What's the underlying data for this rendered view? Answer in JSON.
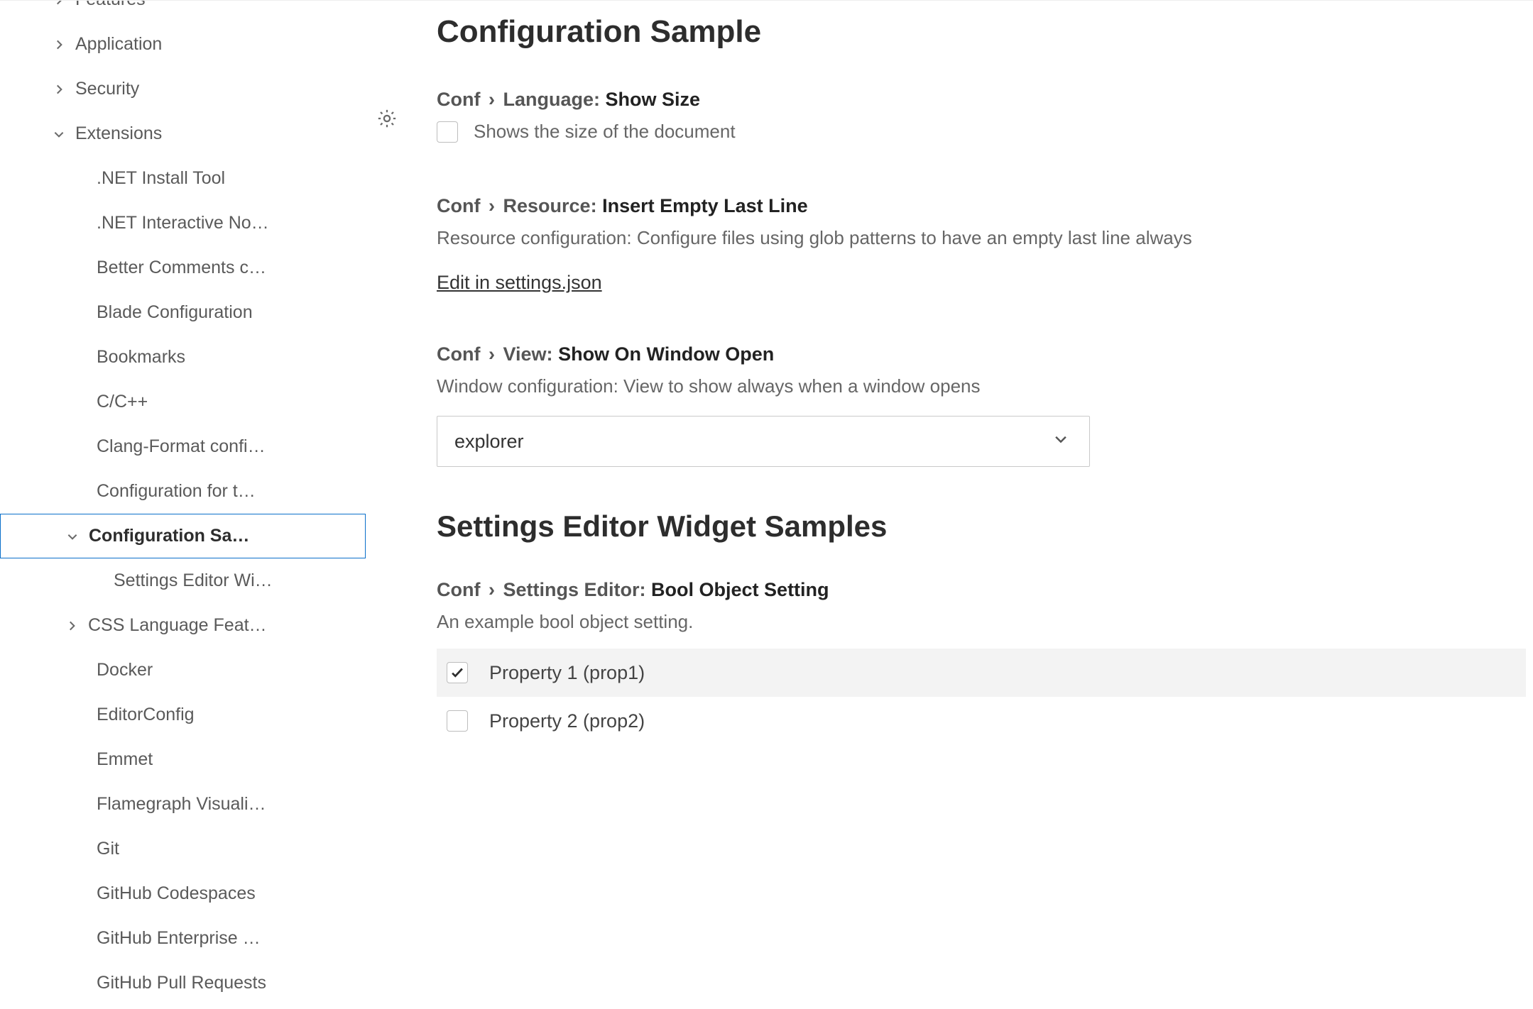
{
  "sidebar": {
    "nodes": [
      {
        "label": "Features",
        "indent": 0,
        "hasChevron": true,
        "chev": "right",
        "selected": false
      },
      {
        "label": "Application",
        "indent": 0,
        "hasChevron": true,
        "chev": "right",
        "selected": false
      },
      {
        "label": "Security",
        "indent": 0,
        "hasChevron": true,
        "chev": "right",
        "selected": false
      },
      {
        "label": "Extensions",
        "indent": 0,
        "hasChevron": true,
        "chev": "down",
        "selected": false
      },
      {
        "label": ".NET Install Tool",
        "indent": 1,
        "hasChevron": false,
        "selected": false
      },
      {
        "label": ".NET Interactive No…",
        "indent": 1,
        "hasChevron": false,
        "selected": false
      },
      {
        "label": "Better Comments c…",
        "indent": 1,
        "hasChevron": false,
        "selected": false
      },
      {
        "label": "Blade Configuration",
        "indent": 1,
        "hasChevron": false,
        "selected": false
      },
      {
        "label": "Bookmarks",
        "indent": 1,
        "hasChevron": false,
        "selected": false
      },
      {
        "label": "C/C++",
        "indent": 1,
        "hasChevron": false,
        "selected": false
      },
      {
        "label": "Clang-Format confi…",
        "indent": 1,
        "hasChevron": false,
        "selected": false
      },
      {
        "label": "Configuration for t…",
        "indent": 1,
        "hasChevron": false,
        "selected": false
      },
      {
        "label": "Configuration Sa…",
        "indent": 1,
        "hasChevron": true,
        "chev": "down",
        "selected": true
      },
      {
        "label": "Settings Editor Wi…",
        "indent": 2,
        "hasChevron": false,
        "selected": false
      },
      {
        "label": "CSS Language Feat…",
        "indent": 1,
        "hasChevron": true,
        "chev": "right",
        "selected": false
      },
      {
        "label": "Docker",
        "indent": 1,
        "hasChevron": false,
        "selected": false
      },
      {
        "label": "EditorConfig",
        "indent": 1,
        "hasChevron": false,
        "selected": false
      },
      {
        "label": "Emmet",
        "indent": 1,
        "hasChevron": false,
        "selected": false
      },
      {
        "label": "Flamegraph Visuali…",
        "indent": 1,
        "hasChevron": false,
        "selected": false
      },
      {
        "label": "Git",
        "indent": 1,
        "hasChevron": false,
        "selected": false
      },
      {
        "label": "GitHub Codespaces",
        "indent": 1,
        "hasChevron": false,
        "selected": false
      },
      {
        "label": "GitHub Enterprise …",
        "indent": 1,
        "hasChevron": false,
        "selected": false
      },
      {
        "label": "GitHub Pull Requests",
        "indent": 1,
        "hasChevron": false,
        "selected": false
      }
    ]
  },
  "main": {
    "heading1": "Configuration Sample",
    "heading2": "Settings Editor Widget Samples",
    "gearVisible": true,
    "settings": {
      "showSize": {
        "scope": "Conf",
        "subscope": "Language:",
        "name": "Show Size",
        "desc": "Shows the size of the document",
        "checked": false
      },
      "insertEmpty": {
        "scope": "Conf",
        "subscope": "Resource:",
        "name": "Insert Empty Last Line",
        "desc": "Resource configuration: Configure files using glob patterns to have an empty last line always",
        "editLink": "Edit in settings.json"
      },
      "showOnOpen": {
        "scope": "Conf",
        "subscope": "View:",
        "name": "Show On Window Open",
        "desc": "Window configuration: View to show always when a window opens",
        "value": "explorer"
      },
      "boolObject": {
        "scope": "Conf",
        "subscope": "Settings Editor:",
        "name": "Bool Object Setting",
        "desc": "An example bool object setting.",
        "props": [
          {
            "label": "Property 1 (prop1)",
            "checked": true,
            "highlight": true
          },
          {
            "label": "Property 2 (prop2)",
            "checked": false,
            "highlight": false
          }
        ]
      }
    }
  }
}
